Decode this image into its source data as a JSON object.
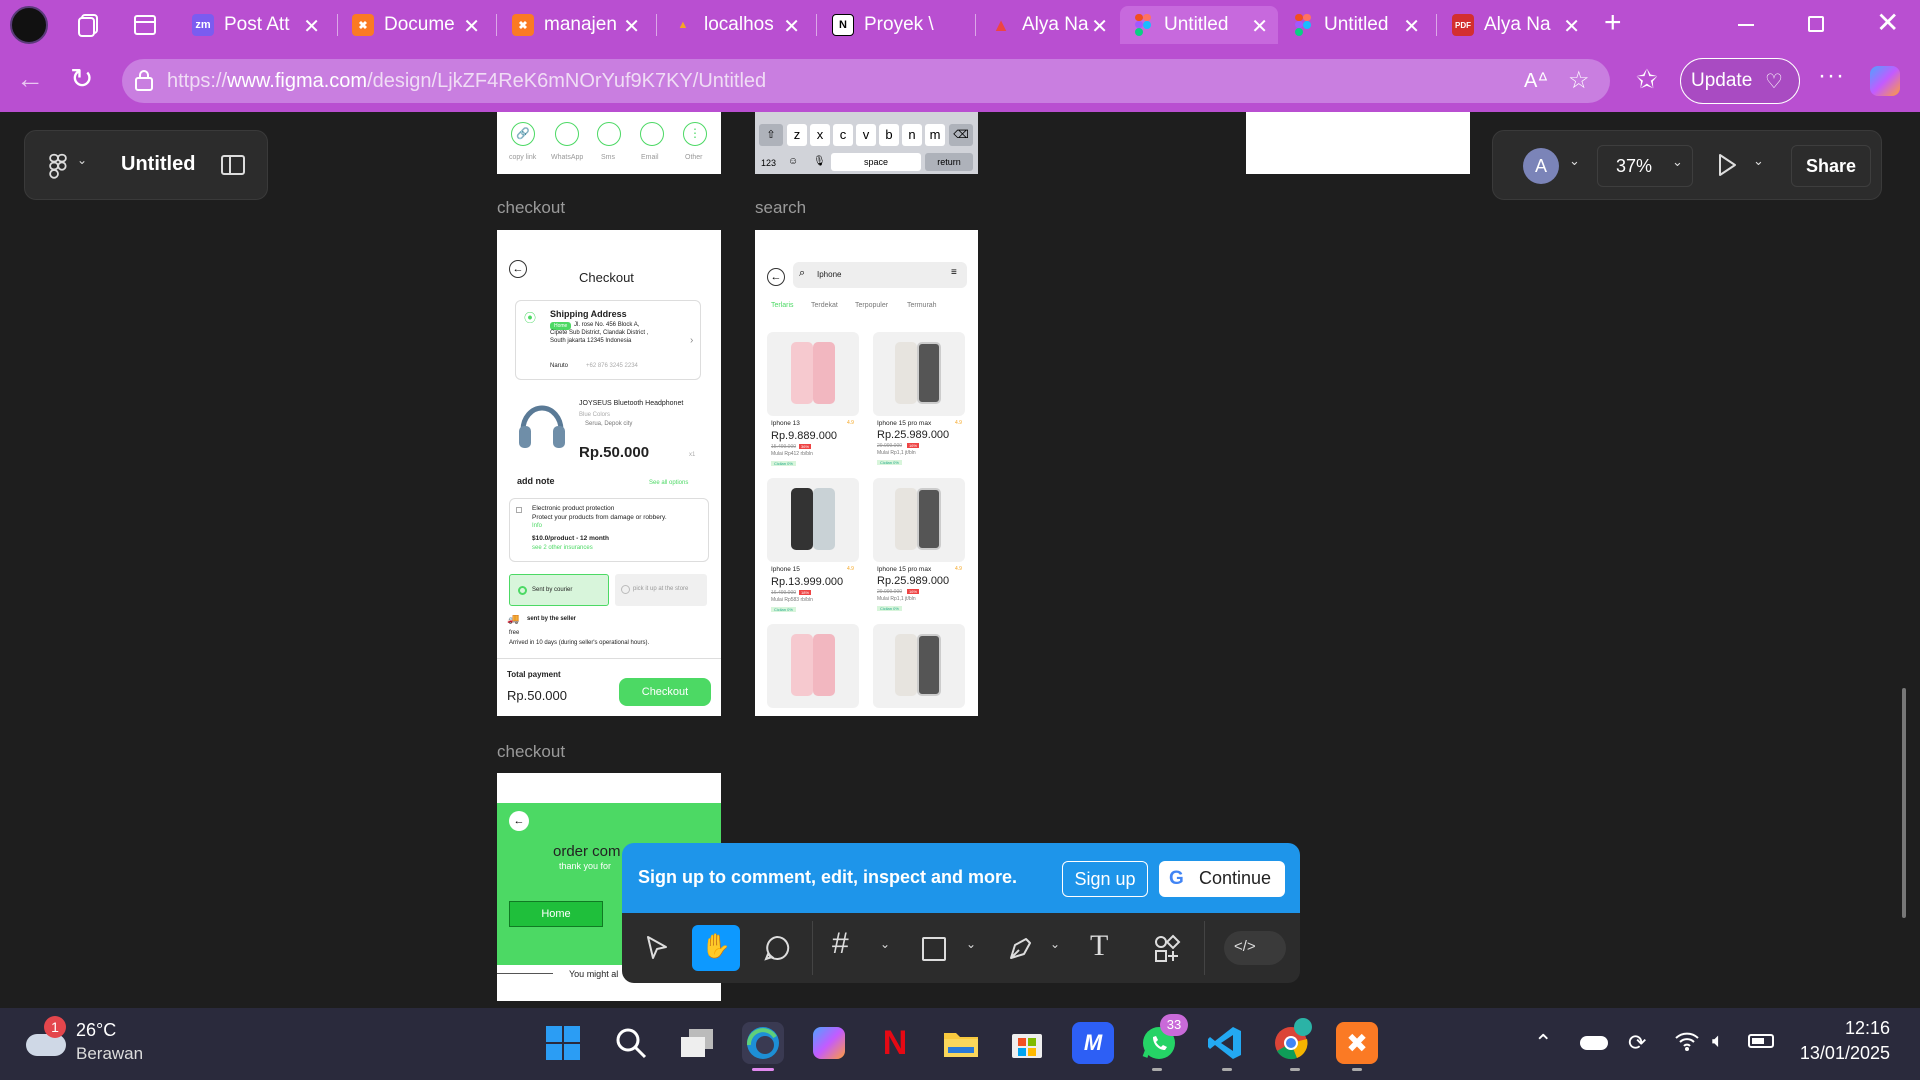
{
  "browser": {
    "tabs": [
      {
        "label": "Post Att",
        "favicon": "zm"
      },
      {
        "label": "Docume",
        "favicon": "xampp"
      },
      {
        "label": "manajen",
        "favicon": "xampp"
      },
      {
        "label": "localhos",
        "favicon": "pma"
      },
      {
        "label": "Proyek \\",
        "favicon": "notion"
      },
      {
        "label": "Alya Na",
        "favicon": "figma-alt"
      },
      {
        "label": "Untitled",
        "favicon": "figma"
      },
      {
        "label": "Untitled",
        "favicon": "figma"
      },
      {
        "label": "Alya Na",
        "favicon": "pdf"
      }
    ],
    "url_prefix": "https://",
    "url_domain": "www.figma.com",
    "url_path": "/design/LjkZF4ReK6mNOrYuf9K7KY/Untitled",
    "update_label": "Update",
    "accent": "#b94fd1"
  },
  "figma": {
    "file_name": "Untitled",
    "avatar_initial": "A",
    "zoom": "37%",
    "share_label": "Share",
    "signup_text": "Sign up to comment, edit, inspect and more.",
    "signup_button": "Sign up",
    "continue_button": "Continue",
    "frames": {
      "checkout_title": "checkout",
      "search_title": "search",
      "checkout2_title": "checkout"
    }
  },
  "share_sheet": {
    "items": [
      "copy link",
      "WhatsApp",
      "Sms",
      "Email",
      "Other"
    ]
  },
  "keyboard": {
    "row": [
      "z",
      "x",
      "c",
      "v",
      "b",
      "n",
      "m"
    ],
    "num": "123",
    "space": "space",
    "return": "return"
  },
  "checkout": {
    "title": "Checkout",
    "address_title": "Shipping Address",
    "address_tag": "Home",
    "address_line1": "Jl. rose No. 456 Block A,",
    "address_line2": "Cipete Sub District, Clandak District ,",
    "address_line3": "South jakarta 12345 Indonesia",
    "recipient": "Naruto",
    "phone": "+62 876 3245 2234",
    "product_name": "JOYSEUS Bluetooth Headphonet",
    "product_color": "Blue Colors",
    "product_store": "Serua, Depok city",
    "product_price": "Rp.50.000",
    "product_qty": "x1",
    "add_note": "add note",
    "see_all": "See all options",
    "protection_title": "Electronic product protection",
    "protection_desc": "Protect your products from damage or robbery.",
    "protection_info": "Info",
    "protection_price": "$10.0/product - 12 month",
    "protection_more": "see 2 other insurances",
    "option_courier": "Sent by courier",
    "option_pickup": "pick it up at the store",
    "seller_label": "sent by the seller",
    "free": "free",
    "arrival": "Arrived in 10 days (during seller's operational hours).",
    "total_label": "Total payment",
    "total_value": "Rp.50.000",
    "checkout_button": "Checkout"
  },
  "search": {
    "query": "Iphone",
    "filters": [
      "Terlaris",
      "Terdekat",
      "Terpopuler",
      "Termurah"
    ],
    "products": [
      {
        "name": "Iphone 13",
        "rating": "4.9",
        "price": "Rp.9.889.000",
        "old": "15.499.000",
        "disc": "36%",
        "install": "Mulai Rp412 rb/bln",
        "tag": "Cicilan 0%"
      },
      {
        "name": "Iphone 15 pro max",
        "rating": "4.9",
        "price": "Rp.25.989.000",
        "old": "29.999.000",
        "disc": "16%",
        "install": "Mulai Rp1,1 jt/bln",
        "tag": "Cicilan 0%"
      },
      {
        "name": "Iphone 15",
        "rating": "4.9",
        "price": "Rp.13.999.000",
        "old": "16.499.000",
        "disc": "18%",
        "install": "Mulai Rp583 rb/bln",
        "tag": "Cicilan 0%"
      },
      {
        "name": "Iphone 15 pro max",
        "rating": "4.9",
        "price": "Rp.25.989.000",
        "old": "29.999.000",
        "disc": "16%",
        "install": "Mulai Rp1,1 jt/bln",
        "tag": "Cicilan 0%"
      }
    ]
  },
  "order": {
    "title": "order com",
    "subtitle": "thank you for",
    "home_button": "Home",
    "you_might": "You might al"
  },
  "taskbar": {
    "weather_temp": "26°C",
    "weather_desc": "Berawan",
    "weather_badge": "1",
    "whatsapp_badge": "33",
    "time": "12:16",
    "date": "13/01/2025"
  }
}
